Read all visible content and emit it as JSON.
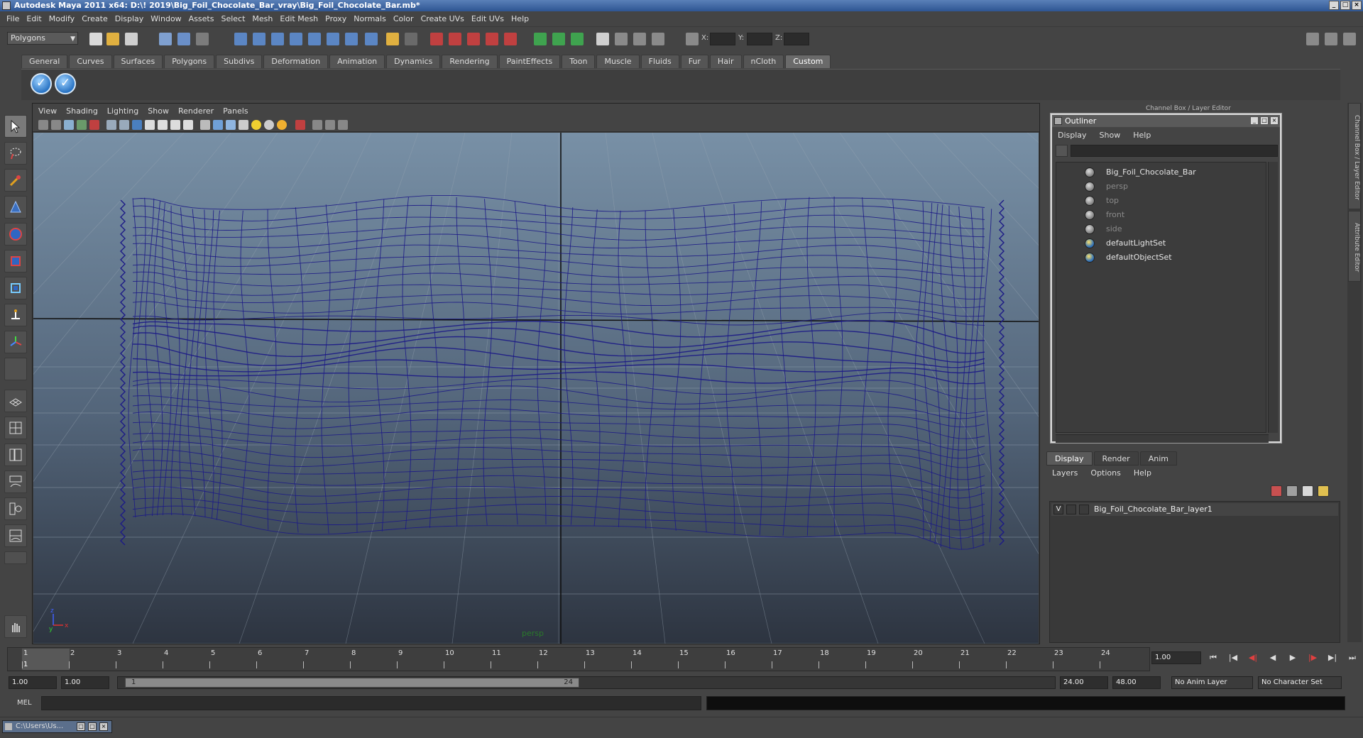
{
  "window": {
    "title": "Autodesk Maya 2011 x64: D:\\! 2019\\Big_Foil_Chocolate_Bar_vray\\Big_Foil_Chocolate_Bar.mb*",
    "controls": [
      "_",
      "□",
      "×"
    ]
  },
  "menubar": [
    "File",
    "Edit",
    "Modify",
    "Create",
    "Display",
    "Window",
    "Assets",
    "Select",
    "Mesh",
    "Edit Mesh",
    "Proxy",
    "Normals",
    "Color",
    "Create UVs",
    "Edit UVs",
    "Help"
  ],
  "statusline": {
    "mode": "Polygons",
    "coord_labels": [
      "X:",
      "Y:",
      "Z:"
    ]
  },
  "shelf": {
    "tabs": [
      "General",
      "Curves",
      "Surfaces",
      "Polygons",
      "Subdivs",
      "Deformation",
      "Animation",
      "Dynamics",
      "Rendering",
      "PaintEffects",
      "Toon",
      "Muscle",
      "Fluids",
      "Fur",
      "Hair",
      "nCloth",
      "Custom"
    ],
    "active_tab": "Custom",
    "buttons": [
      "✓",
      "✓"
    ]
  },
  "viewport": {
    "menu": [
      "View",
      "Shading",
      "Lighting",
      "Show",
      "Renderer",
      "Panels"
    ],
    "camera_label": "persp",
    "axis": {
      "y": "y",
      "x": "x",
      "z": "z"
    }
  },
  "outliner": {
    "title": "Outliner",
    "menu": [
      "Display",
      "Show",
      "Help"
    ],
    "items": [
      {
        "name": "Big_Foil_Chocolate_Bar",
        "dim": false,
        "icon": "mesh-group-icon"
      },
      {
        "name": "persp",
        "dim": true,
        "icon": "camera-icon"
      },
      {
        "name": "top",
        "dim": true,
        "icon": "camera-icon"
      },
      {
        "name": "front",
        "dim": true,
        "icon": "camera-icon"
      },
      {
        "name": "side",
        "dim": true,
        "icon": "camera-icon"
      },
      {
        "name": "defaultLightSet",
        "dim": false,
        "icon": "set-icon"
      },
      {
        "name": "defaultObjectSet",
        "dim": false,
        "icon": "set-icon"
      }
    ]
  },
  "channel_box_label": "Channel Box / Layer Editor",
  "side_tabs": [
    "Channel Box / Layer Editor",
    "Attribute Editor"
  ],
  "layer_editor": {
    "tabs": [
      "Display",
      "Render",
      "Anim"
    ],
    "active_tab": "Display",
    "menu": [
      "Layers",
      "Options",
      "Help"
    ],
    "layer": {
      "visible": "V",
      "name": "Big_Foil_Chocolate_Bar_layer1"
    }
  },
  "timeline": {
    "frames": [
      "1",
      "2",
      "3",
      "4",
      "5",
      "6",
      "7",
      "8",
      "9",
      "10",
      "11",
      "12",
      "13",
      "14",
      "15",
      "16",
      "17",
      "18",
      "19",
      "20",
      "21",
      "22",
      "23",
      "24"
    ],
    "current_frame_label": "1",
    "current_frame": "1.00"
  },
  "range": {
    "start": "1.00",
    "playback_start": "1.00",
    "thumb_start": "1",
    "thumb_end": "24",
    "playback_end": "24.00",
    "end": "48.00",
    "anim_layer": "No Anim Layer",
    "character_set": "No Character Set"
  },
  "cmdline": {
    "label": "MEL"
  },
  "taskbar": {
    "window": "C:\\Users\\Us..."
  },
  "colors": {
    "wireframe": "#1c1a86",
    "viewport_top": "#7890a6",
    "viewport_bottom": "#2d3440",
    "title_bar": "#2e5592"
  }
}
